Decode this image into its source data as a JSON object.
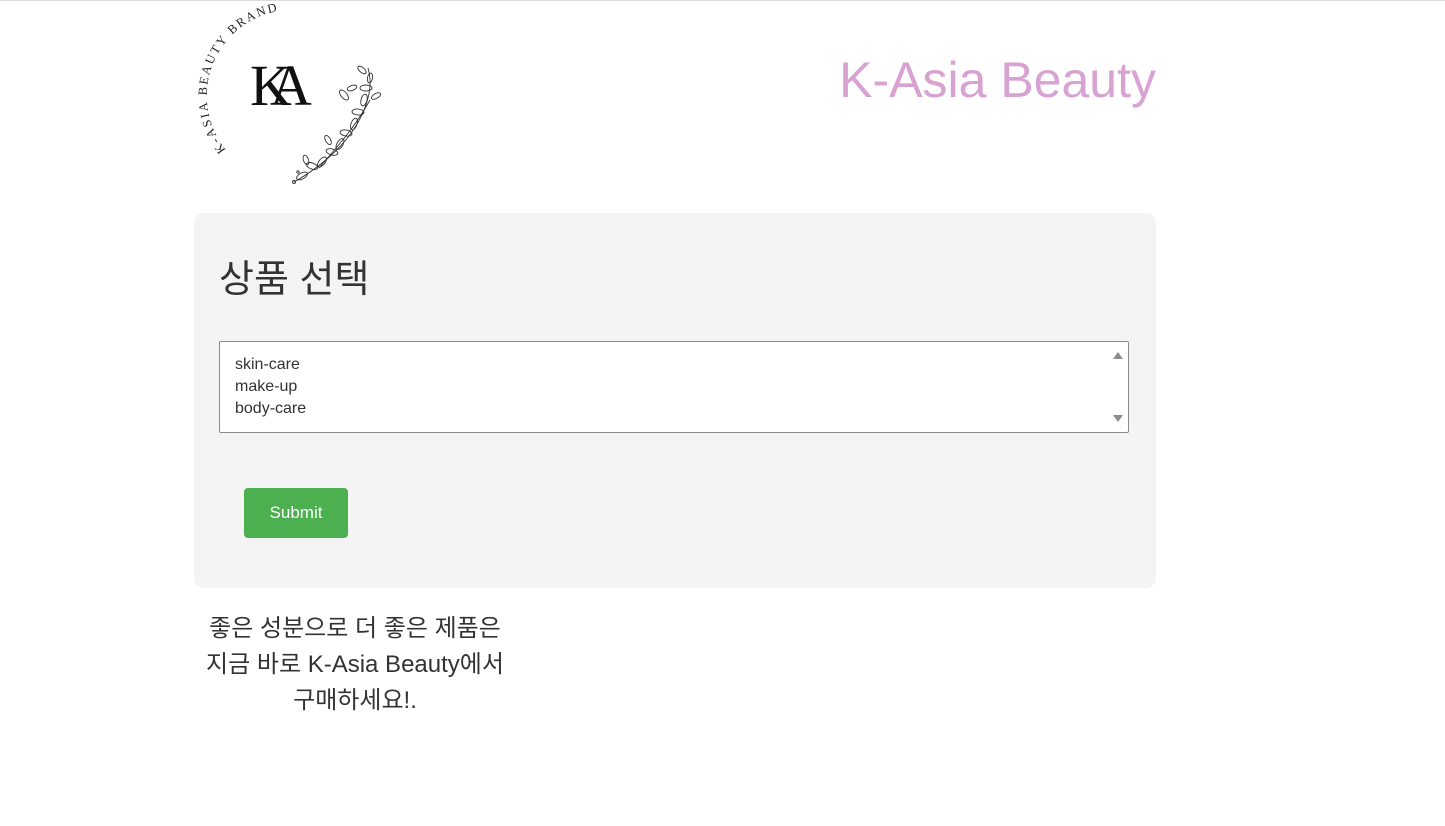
{
  "header": {
    "logo": {
      "monogram": "KA",
      "arc_text": "K-ASIA BEAUTY BRAND",
      "icon": "floral-branch-icon"
    },
    "brand_title": "K-Asia Beauty"
  },
  "form": {
    "title": "상품 선택",
    "product_options": [
      "skin-care",
      "make-up",
      "body-care"
    ],
    "submit_label": "Submit"
  },
  "tagline": "좋은 성분으로 더 좋은 제품은 지금 바로 K-Asia Beauty에서 구매하세요!.",
  "colors": {
    "brand_title": "#d8a2d3",
    "submit_button": "#4caf50",
    "panel_background": "#f4f4f4",
    "text": "#333333"
  }
}
